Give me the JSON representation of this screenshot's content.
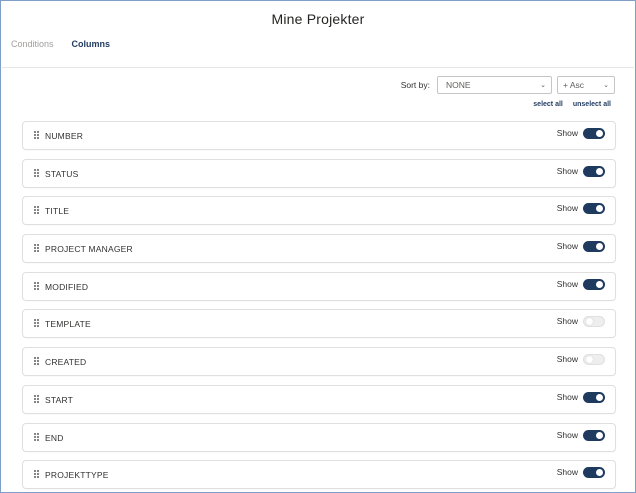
{
  "dialog": {
    "title": "Mine Projekter"
  },
  "tabs": [
    {
      "label": "Conditions",
      "active": false
    },
    {
      "label": "Columns",
      "active": true
    }
  ],
  "sort": {
    "label": "Sort by:",
    "field_value": "NONE",
    "direction_value": "+ Asc"
  },
  "selection": {
    "select_all": "select all",
    "unselect_all": "unselect all"
  },
  "columns": [
    {
      "label": "NUMBER",
      "show_label": "Show",
      "shown": true
    },
    {
      "label": "STATUS",
      "show_label": "Show",
      "shown": true
    },
    {
      "label": "TITLE",
      "show_label": "Show",
      "shown": true
    },
    {
      "label": "PROJECT MANAGER",
      "show_label": "Show",
      "shown": true
    },
    {
      "label": "MODIFIED",
      "show_label": "Show",
      "shown": true
    },
    {
      "label": "TEMPLATE",
      "show_label": "Show",
      "shown": false
    },
    {
      "label": "CREATED",
      "show_label": "Show",
      "shown": false
    },
    {
      "label": "START",
      "show_label": "Show",
      "shown": true
    },
    {
      "label": "END",
      "show_label": "Show",
      "shown": true
    },
    {
      "label": "PROJEKTTYPE",
      "show_label": "Show",
      "shown": true
    }
  ],
  "colors": {
    "accent": "#1f3a5f",
    "toggle_off": "#eeeeee",
    "frame_border": "#7f9fc7"
  },
  "icons": {
    "drag": "drag-handle-icon",
    "chevron": "chevron-down-icon"
  }
}
